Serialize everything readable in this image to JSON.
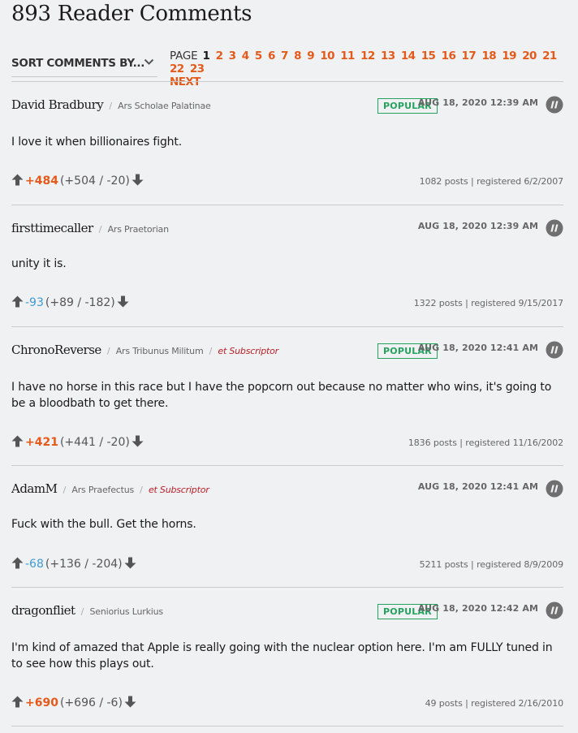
{
  "header": {
    "title": "893 Reader Comments"
  },
  "sort": {
    "label": "SORT COMMENTS BY..."
  },
  "pagination": {
    "label": "PAGE",
    "pages": [
      "1",
      "2",
      "3",
      "4",
      "5",
      "6",
      "7",
      "8",
      "9",
      "10",
      "11",
      "12",
      "13",
      "14",
      "15",
      "16",
      "17",
      "18",
      "19",
      "20",
      "21",
      "22",
      "23"
    ],
    "current": "1",
    "next_label": "NEXT"
  },
  "comments": [
    {
      "author": "David Bradbury",
      "rank": "Ars Scholae Palatinae",
      "subscriber": "",
      "popular": "POPULAR",
      "timestamp": "AUG 18, 2020 12:39 AM",
      "body": "I love it when billionaires fight.",
      "score": "+484",
      "score_sign": "positive",
      "breakdown": "(+504 / -20)",
      "posts": "1082 posts",
      "registered": "registered 6/2/2007"
    },
    {
      "author": "firsttimecaller",
      "rank": "Ars Praetorian",
      "subscriber": "",
      "popular": "",
      "timestamp": "AUG 18, 2020 12:39 AM",
      "body": "unity it is.",
      "score": "-93",
      "score_sign": "negative",
      "breakdown": "(+89 / -182)",
      "posts": "1322 posts",
      "registered": "registered 9/15/2017"
    },
    {
      "author": "ChronoReverse",
      "rank": "Ars Tribunus Militum",
      "subscriber": "et Subscriptor",
      "popular": "POPULAR",
      "timestamp": "AUG 18, 2020 12:41 AM",
      "body": "I have no horse in this race but I have the popcorn out because no matter who wins, it's going to be a bloodbath to get there.",
      "score": "+421",
      "score_sign": "positive",
      "breakdown": "(+441 / -20)",
      "posts": "1836 posts",
      "registered": "registered 11/16/2002"
    },
    {
      "author": "AdamM",
      "rank": "Ars Praefectus",
      "subscriber": "et Subscriptor",
      "popular": "",
      "timestamp": "AUG 18, 2020 12:41 AM",
      "body": "Fuck with the bull. Get the horns.",
      "score": "-68",
      "score_sign": "negative",
      "breakdown": "(+136 / -204)",
      "posts": "5211 posts",
      "registered": "registered 8/9/2009"
    },
    {
      "author": "dragonfliet",
      "rank": "Seniorius Lurkius",
      "subscriber": "",
      "popular": "POPULAR",
      "timestamp": "AUG 18, 2020 12:42 AM",
      "body": "I'm kind of amazed that Apple is really going with the nuclear option here. I'm am FULLY tuned in to see how this plays out.",
      "score": "+690",
      "score_sign": "positive",
      "breakdown": "(+696 / -6)",
      "posts": "49 posts",
      "registered": "registered 2/16/2010"
    }
  ],
  "icons": {
    "sort_toggle": "chevron-down-icon",
    "upvote": "arrow-up-icon",
    "downvote": "arrow-down-icon",
    "reply": "quote-icon"
  },
  "colors": {
    "accent": "#e45a1b",
    "negative_score": "#3e9bd4",
    "popular": "#25a160",
    "subscriber": "#b8202a"
  }
}
